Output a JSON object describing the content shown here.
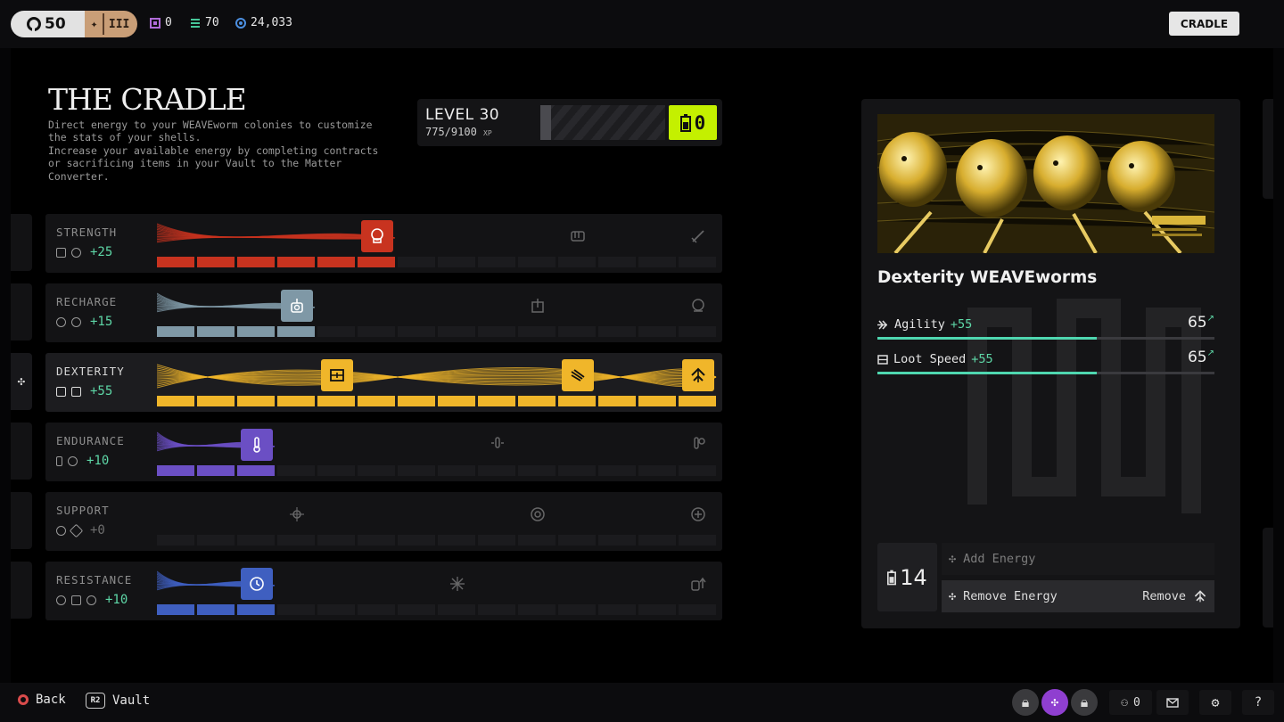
{
  "topbar": {
    "player_level": "50",
    "rank_numeral": "III",
    "currency_purple": "0",
    "currency_green": "70",
    "currency_blue": "24,033",
    "cradle_button": "CRADLE"
  },
  "page": {
    "title": "THE CRADLE",
    "description": "Direct energy to your WEAVEworm colonies to customize\nthe stats of your shells.\nIncrease your available energy by completing contracts\nor sacrificing items in your Vault to the Matter\nConverter."
  },
  "level": {
    "label": "LEVEL 30",
    "xp": "775/9100",
    "xp_unit": "XP",
    "xp_current": 775,
    "xp_max": 9100,
    "energy_available": "0"
  },
  "stats": [
    {
      "name": "STRENGTH",
      "bonus": "+25",
      "color": "#c8331f",
      "filled": 6,
      "selected": false,
      "sub_icons": [
        "shield-fist-icon",
        "aim-icon"
      ]
    },
    {
      "name": "RECHARGE",
      "bonus": "+15",
      "color": "#7f98a6",
      "filled": 4,
      "selected": false,
      "sub_icons": [
        "radio-icon",
        "target-icon"
      ]
    },
    {
      "name": "DEXTERITY",
      "bonus": "+55",
      "color": "#f0b62a",
      "filled": 14,
      "selected": true,
      "sub_icons": [
        "dash-arrows-icon",
        "box-icon"
      ]
    },
    {
      "name": "ENDURANCE",
      "bonus": "+10",
      "color": "#6b4fc4",
      "filled": 3,
      "selected": false,
      "sub_icons": [
        "thermometer-icon",
        "flask-icon"
      ]
    },
    {
      "name": "SUPPORT",
      "bonus": "+0",
      "color": "#9c9c9c",
      "filled": 0,
      "selected": false,
      "sub_icons": [
        "crosshair-icon",
        "diamond-icon"
      ]
    },
    {
      "name": "RESISTANCE",
      "bonus": "+10",
      "color": "#3f5fc0",
      "filled": 3,
      "selected": false,
      "sub_icons": [
        "flame-icon",
        "wrench-icon",
        "sound-icon"
      ]
    }
  ],
  "panel": {
    "title": "Dexterity WEAVEworms",
    "substats": [
      {
        "label": "Agility",
        "bonus": "+55",
        "value": "65",
        "fill": 0.65
      },
      {
        "label": "Loot Speed",
        "bonus": "+55",
        "value": "65",
        "fill": 0.65
      }
    ],
    "energy_count": "14",
    "add_energy": "Add Energy",
    "remove_energy": "Remove Energy",
    "remove_hint": "Remove"
  },
  "bottombar": {
    "back": "Back",
    "vault_key": "R2",
    "vault": "Vault",
    "party_count": "0"
  },
  "colors": {
    "accent_lime": "#c4f000",
    "accent_teal": "#4fd7b0",
    "plus_green": "#5ed7a7"
  }
}
